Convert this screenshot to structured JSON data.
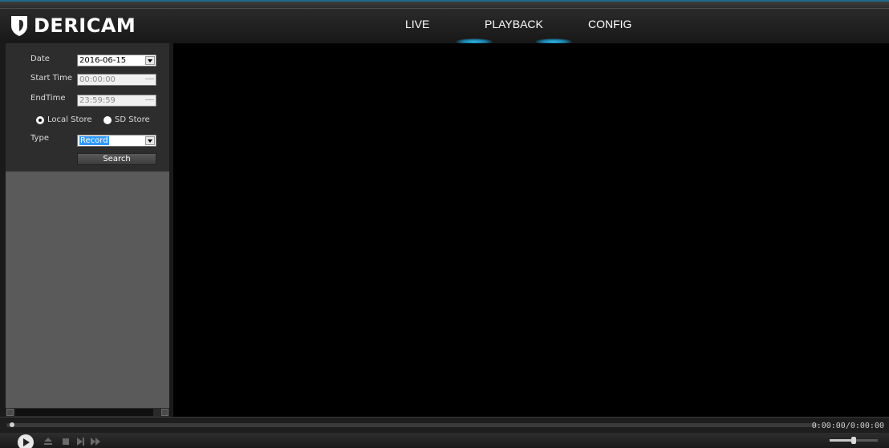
{
  "header": {
    "brand": "DERICAM",
    "nav": [
      {
        "label": "LIVE"
      },
      {
        "label": "PLAYBACK"
      },
      {
        "label": "CONFIG"
      }
    ],
    "accent_color": "#2fb6e6"
  },
  "search_panel": {
    "date_label": "Date",
    "date_value": "2016-06-15",
    "start_time_label": "Start Time",
    "start_time_value": "00:00:00",
    "end_time_label": "EndTime",
    "end_time_value": "23:59:59",
    "store_options": [
      {
        "label": "Local Store",
        "selected": true
      },
      {
        "label": "SD Store",
        "selected": false
      }
    ],
    "type_label": "Type",
    "type_value": "Record",
    "search_button": "Search"
  },
  "player": {
    "time_readout": "0:00:00/0:00:00",
    "progress_fraction": 0.0,
    "volume_fraction": 0.5,
    "controls": [
      "play-icon",
      "eject-icon",
      "stop-icon",
      "step-forward-icon",
      "fast-forward-icon"
    ]
  }
}
